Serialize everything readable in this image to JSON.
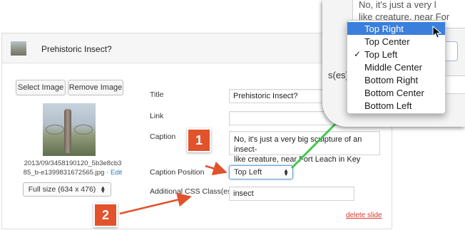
{
  "header": {
    "title": "Prehistoric Insect?"
  },
  "image_panel": {
    "select_image_label": "Select Image",
    "remove_image_label": "Remove Image",
    "file_name_line1": "2013/09/3458190120_5b3e8cb3",
    "file_name_line2": "85_b-e1399831672565.jpg",
    "separator": " · ",
    "edit_label": "Edit",
    "size_select_value": "Full size (634 x 476)"
  },
  "form": {
    "title_label": "Title",
    "title_value": "Prehistoric Insect?",
    "link_label": "Link",
    "link_value": "",
    "caption_label": "Caption",
    "caption_line1": "No, it's just a very big sculpture of an insect-",
    "caption_line2": "like creature, near Fort Leach in Key West.",
    "caption_position_label": "Caption Position",
    "caption_position_value": "Top Left",
    "css_label": "Additional CSS Class(es)",
    "css_value": "insect",
    "delete_label": "delete slide"
  },
  "callouts": {
    "badge1": "1",
    "badge2": "2"
  },
  "zoom": {
    "caption_line1": "No, it's just a very l",
    "caption_line2": "like creature, near For",
    "label_fragment": "s(es)",
    "menu_items": [
      {
        "label": "Top Right",
        "highlighted": true,
        "checked": false
      },
      {
        "label": "Top Center",
        "highlighted": false,
        "checked": false
      },
      {
        "label": "Top Left",
        "highlighted": false,
        "checked": true
      },
      {
        "label": "Middle Center",
        "highlighted": false,
        "checked": false
      },
      {
        "label": "Bottom Right",
        "highlighted": false,
        "checked": false
      },
      {
        "label": "Bottom Center",
        "highlighted": false,
        "checked": false
      },
      {
        "label": "Bottom Left",
        "highlighted": false,
        "checked": false
      }
    ],
    "check_glyph": "✓"
  },
  "colors": {
    "accent_red": "#e2522b",
    "arrow_green": "#3ec94a",
    "menu_highlight": "#3a7fdc",
    "delete_red": "#d93b2f"
  },
  "icons": {
    "stepper": "updown-arrows-icon",
    "cursor": "mouse-pointer-icon",
    "check": "checkmark-icon"
  }
}
